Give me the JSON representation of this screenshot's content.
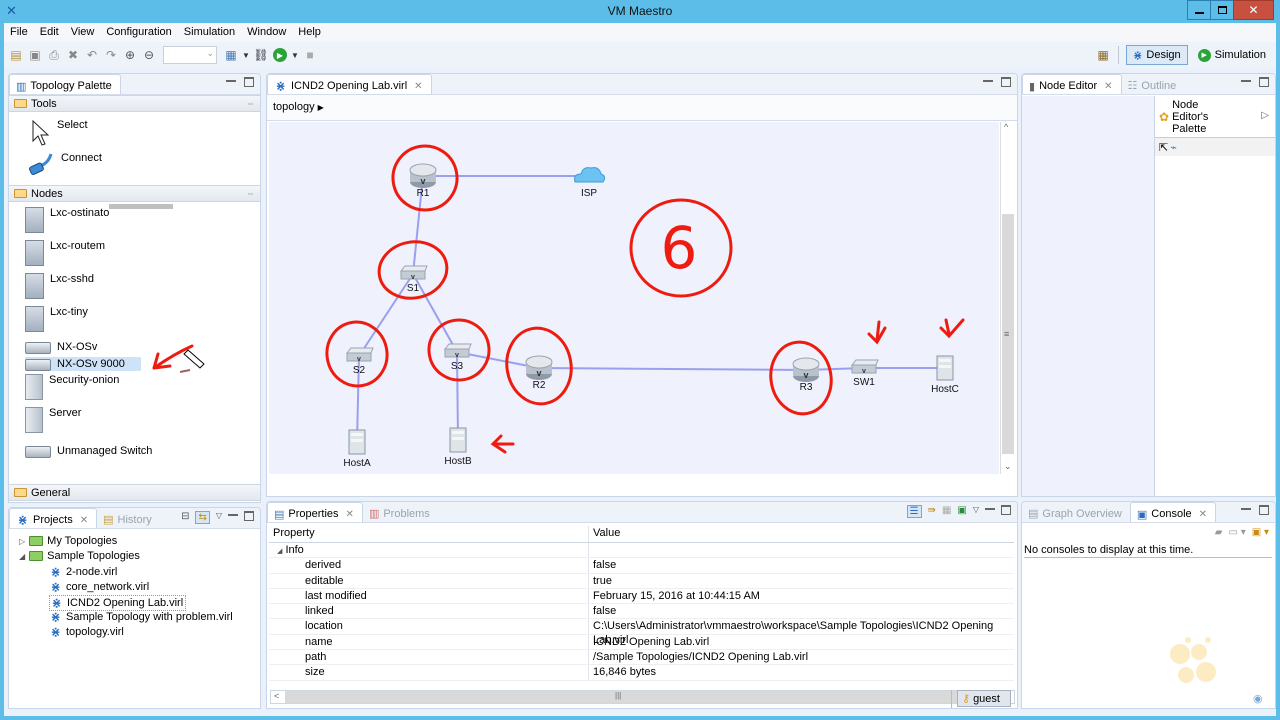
{
  "window": {
    "title": "VM Maestro",
    "app_icon": "vm-maestro-logo"
  },
  "menu": [
    "File",
    "Edit",
    "View",
    "Configuration",
    "Simulation",
    "Window",
    "Help"
  ],
  "toolbar": {
    "zoom_value": "",
    "icons": [
      "new-icon",
      "save-icon",
      "print-icon",
      "delete-icon",
      "undo-icon",
      "redo-icon",
      "zoom-in-icon",
      "zoom-out-icon",
      "layout-icon",
      "build-icon",
      "start-simulation-icon",
      "stop-icon"
    ]
  },
  "perspectives": {
    "design": "Design",
    "simulation": "Simulation"
  },
  "palette": {
    "tab": "Topology Palette",
    "tools_header": "Tools",
    "tools": [
      {
        "label": "Select",
        "icon": "arrow-cursor-icon"
      },
      {
        "label": "Connect",
        "icon": "cable-icon"
      }
    ],
    "nodes_header": "Nodes",
    "nodes": [
      {
        "label": "Lxc-ostinato",
        "icon": "rack-icon"
      },
      {
        "label": "Lxc-routem",
        "icon": "rack-icon"
      },
      {
        "label": "Lxc-sshd",
        "icon": "rack-icon"
      },
      {
        "label": "Lxc-tiny",
        "icon": "rack-icon"
      },
      {
        "label": "NX-OSv",
        "icon": "switch-icon"
      },
      {
        "label": "NX-OSv 9000",
        "icon": "switch-icon",
        "selected": true
      },
      {
        "label": "Security-onion",
        "icon": "server-icon"
      },
      {
        "label": "Server",
        "icon": "server-icon"
      },
      {
        "label": "Unmanaged Switch",
        "icon": "switch-icon"
      }
    ],
    "general_header": "General"
  },
  "editor": {
    "tab": "ICND2 Opening Lab.virl",
    "breadcrumb": "topology",
    "annotation_number": "6",
    "nodes": [
      {
        "id": "R1",
        "label": "R1",
        "type": "router"
      },
      {
        "id": "ISP",
        "label": "ISP",
        "type": "cloud"
      },
      {
        "id": "S1",
        "label": "S1",
        "type": "switch"
      },
      {
        "id": "S2",
        "label": "S2",
        "type": "switch"
      },
      {
        "id": "S3",
        "label": "S3",
        "type": "switch"
      },
      {
        "id": "R2",
        "label": "R2",
        "type": "router"
      },
      {
        "id": "R3",
        "label": "R3",
        "type": "router"
      },
      {
        "id": "SW1",
        "label": "SW1",
        "type": "switch"
      },
      {
        "id": "HostA",
        "label": "HostA",
        "type": "server"
      },
      {
        "id": "HostB",
        "label": "HostB",
        "type": "server"
      },
      {
        "id": "HostC",
        "label": "HostC",
        "type": "server"
      }
    ],
    "links": [
      [
        "R1",
        "ISP"
      ],
      [
        "R1",
        "S1"
      ],
      [
        "S1",
        "S2"
      ],
      [
        "S1",
        "S3"
      ],
      [
        "S3",
        "R2"
      ],
      [
        "R2",
        "R3"
      ],
      [
        "R3",
        "SW1"
      ],
      [
        "SW1",
        "HostC"
      ],
      [
        "S2",
        "HostA"
      ],
      [
        "S3",
        "HostB"
      ]
    ]
  },
  "node_editor": {
    "tab": "Node Editor",
    "outline_tab": "Outline",
    "palette_label": "Node Editor's Palette"
  },
  "projects": {
    "tab": "Projects",
    "history_tab": "History",
    "tree": [
      {
        "label": "My Topologies",
        "level": 0,
        "expanded": false,
        "type": "folder"
      },
      {
        "label": "Sample Topologies",
        "level": 0,
        "expanded": true,
        "type": "folder"
      },
      {
        "label": "2-node.virl",
        "level": 1,
        "type": "file"
      },
      {
        "label": "core_network.virl",
        "level": 1,
        "type": "file"
      },
      {
        "label": "ICND2 Opening Lab.virl",
        "level": 1,
        "type": "file",
        "selected": true
      },
      {
        "label": "Sample Topology with problem.virl",
        "level": 1,
        "type": "file"
      },
      {
        "label": "topology.virl",
        "level": 1,
        "type": "file"
      }
    ]
  },
  "properties": {
    "tab": "Properties",
    "problems_tab": "Problems",
    "col_property": "Property",
    "col_value": "Value",
    "group": "Info",
    "rows": [
      {
        "property": "derived",
        "value": "false"
      },
      {
        "property": "editable",
        "value": "true"
      },
      {
        "property": "last modified",
        "value": "February 15, 2016 at 10:44:15 AM"
      },
      {
        "property": "linked",
        "value": "false"
      },
      {
        "property": "location",
        "value": "C:\\Users\\Administrator\\vmmaestro\\workspace\\Sample Topologies\\ICND2 Opening Lab.virl"
      },
      {
        "property": "name",
        "value": "ICND2 Opening Lab.virl"
      },
      {
        "property": "path",
        "value": "/Sample Topologies/ICND2 Opening Lab.virl"
      },
      {
        "property": "size",
        "value": "16,846  bytes"
      }
    ]
  },
  "console": {
    "graph_tab": "Graph Overview",
    "tab": "Console",
    "message": "No consoles to display at this time."
  },
  "status": {
    "user": "guest"
  },
  "colors": {
    "annotation": "#ee1c10",
    "link": "#9b9ff0",
    "canvas": "#eff1fc",
    "accent": "#5bbde8"
  }
}
